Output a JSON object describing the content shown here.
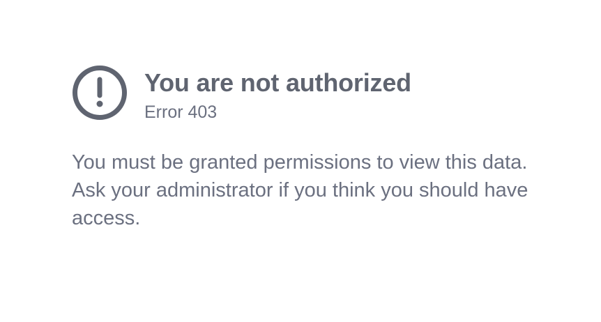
{
  "error": {
    "title": "You are not authorized",
    "code_text": "Error 403",
    "message": "You must be granted permissions to view this data. Ask your administrator if you think you should have access.",
    "icon": "exclamation-circle-icon"
  },
  "colors": {
    "text": "#5f6470",
    "icon": "#5f6470",
    "background": "#ffffff"
  }
}
